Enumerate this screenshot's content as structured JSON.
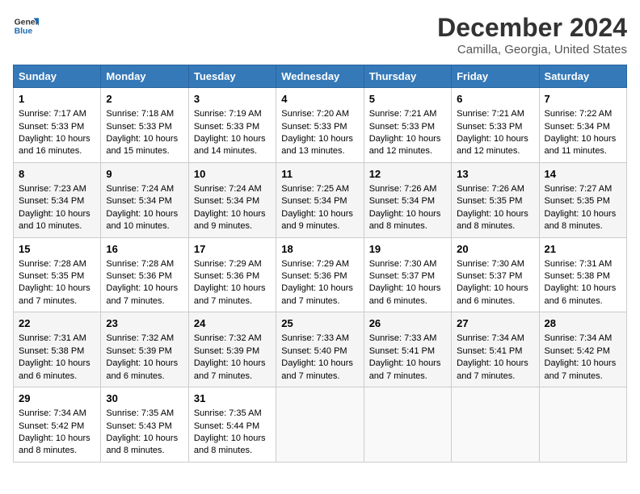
{
  "header": {
    "logo_line1": "General",
    "logo_line2": "Blue",
    "main_title": "December 2024",
    "subtitle": "Camilla, Georgia, United States"
  },
  "days_of_week": [
    "Sunday",
    "Monday",
    "Tuesday",
    "Wednesday",
    "Thursday",
    "Friday",
    "Saturday"
  ],
  "weeks": [
    [
      {
        "day": "1",
        "sunrise": "7:17 AM",
        "sunset": "5:33 PM",
        "daylight": "10 hours and 16 minutes."
      },
      {
        "day": "2",
        "sunrise": "7:18 AM",
        "sunset": "5:33 PM",
        "daylight": "10 hours and 15 minutes."
      },
      {
        "day": "3",
        "sunrise": "7:19 AM",
        "sunset": "5:33 PM",
        "daylight": "10 hours and 14 minutes."
      },
      {
        "day": "4",
        "sunrise": "7:20 AM",
        "sunset": "5:33 PM",
        "daylight": "10 hours and 13 minutes."
      },
      {
        "day": "5",
        "sunrise": "7:21 AM",
        "sunset": "5:33 PM",
        "daylight": "10 hours and 12 minutes."
      },
      {
        "day": "6",
        "sunrise": "7:21 AM",
        "sunset": "5:33 PM",
        "daylight": "10 hours and 12 minutes."
      },
      {
        "day": "7",
        "sunrise": "7:22 AM",
        "sunset": "5:34 PM",
        "daylight": "10 hours and 11 minutes."
      }
    ],
    [
      {
        "day": "8",
        "sunrise": "7:23 AM",
        "sunset": "5:34 PM",
        "daylight": "10 hours and 10 minutes."
      },
      {
        "day": "9",
        "sunrise": "7:24 AM",
        "sunset": "5:34 PM",
        "daylight": "10 hours and 10 minutes."
      },
      {
        "day": "10",
        "sunrise": "7:24 AM",
        "sunset": "5:34 PM",
        "daylight": "10 hours and 9 minutes."
      },
      {
        "day": "11",
        "sunrise": "7:25 AM",
        "sunset": "5:34 PM",
        "daylight": "10 hours and 9 minutes."
      },
      {
        "day": "12",
        "sunrise": "7:26 AM",
        "sunset": "5:34 PM",
        "daylight": "10 hours and 8 minutes."
      },
      {
        "day": "13",
        "sunrise": "7:26 AM",
        "sunset": "5:35 PM",
        "daylight": "10 hours and 8 minutes."
      },
      {
        "day": "14",
        "sunrise": "7:27 AM",
        "sunset": "5:35 PM",
        "daylight": "10 hours and 8 minutes."
      }
    ],
    [
      {
        "day": "15",
        "sunrise": "7:28 AM",
        "sunset": "5:35 PM",
        "daylight": "10 hours and 7 minutes."
      },
      {
        "day": "16",
        "sunrise": "7:28 AM",
        "sunset": "5:36 PM",
        "daylight": "10 hours and 7 minutes."
      },
      {
        "day": "17",
        "sunrise": "7:29 AM",
        "sunset": "5:36 PM",
        "daylight": "10 hours and 7 minutes."
      },
      {
        "day": "18",
        "sunrise": "7:29 AM",
        "sunset": "5:36 PM",
        "daylight": "10 hours and 7 minutes."
      },
      {
        "day": "19",
        "sunrise": "7:30 AM",
        "sunset": "5:37 PM",
        "daylight": "10 hours and 6 minutes."
      },
      {
        "day": "20",
        "sunrise": "7:30 AM",
        "sunset": "5:37 PM",
        "daylight": "10 hours and 6 minutes."
      },
      {
        "day": "21",
        "sunrise": "7:31 AM",
        "sunset": "5:38 PM",
        "daylight": "10 hours and 6 minutes."
      }
    ],
    [
      {
        "day": "22",
        "sunrise": "7:31 AM",
        "sunset": "5:38 PM",
        "daylight": "10 hours and 6 minutes."
      },
      {
        "day": "23",
        "sunrise": "7:32 AM",
        "sunset": "5:39 PM",
        "daylight": "10 hours and 6 minutes."
      },
      {
        "day": "24",
        "sunrise": "7:32 AM",
        "sunset": "5:39 PM",
        "daylight": "10 hours and 7 minutes."
      },
      {
        "day": "25",
        "sunrise": "7:33 AM",
        "sunset": "5:40 PM",
        "daylight": "10 hours and 7 minutes."
      },
      {
        "day": "26",
        "sunrise": "7:33 AM",
        "sunset": "5:41 PM",
        "daylight": "10 hours and 7 minutes."
      },
      {
        "day": "27",
        "sunrise": "7:34 AM",
        "sunset": "5:41 PM",
        "daylight": "10 hours and 7 minutes."
      },
      {
        "day": "28",
        "sunrise": "7:34 AM",
        "sunset": "5:42 PM",
        "daylight": "10 hours and 7 minutes."
      }
    ],
    [
      {
        "day": "29",
        "sunrise": "7:34 AM",
        "sunset": "5:42 PM",
        "daylight": "10 hours and 8 minutes."
      },
      {
        "day": "30",
        "sunrise": "7:35 AM",
        "sunset": "5:43 PM",
        "daylight": "10 hours and 8 minutes."
      },
      {
        "day": "31",
        "sunrise": "7:35 AM",
        "sunset": "5:44 PM",
        "daylight": "10 hours and 8 minutes."
      },
      null,
      null,
      null,
      null
    ]
  ]
}
